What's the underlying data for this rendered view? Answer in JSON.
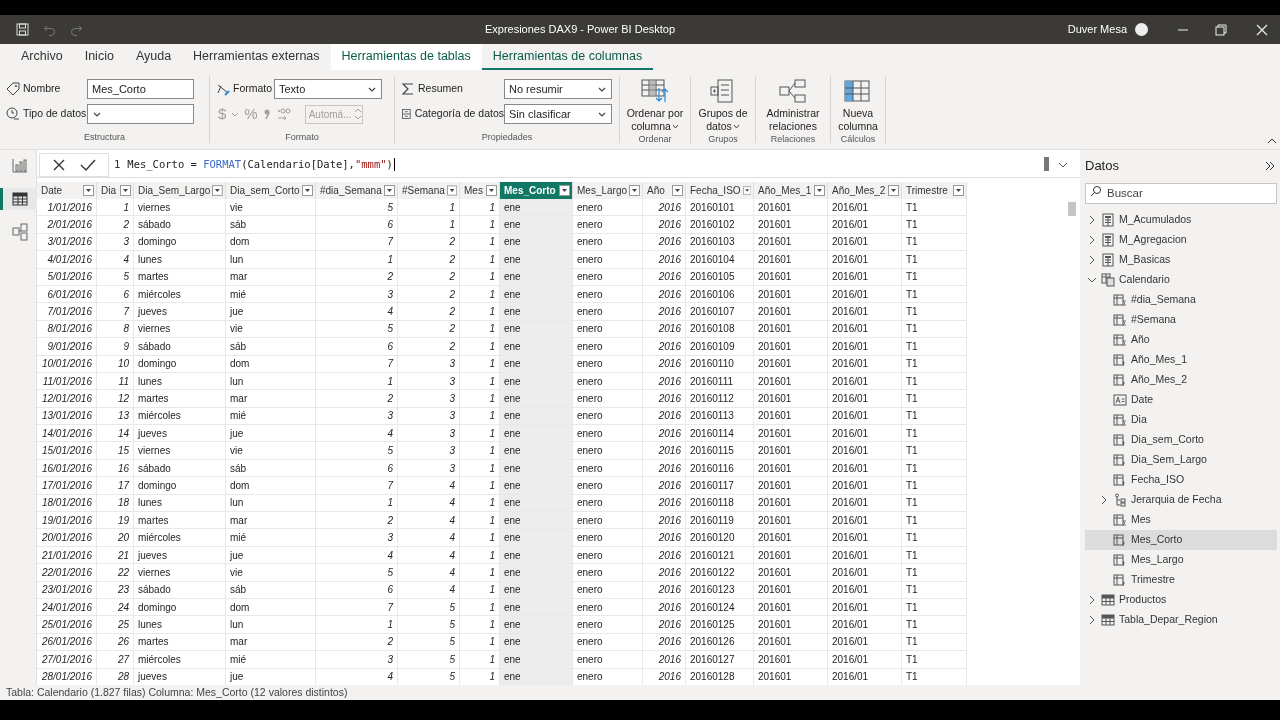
{
  "window": {
    "title": "Expresiones DAX9 - Power BI Desktop",
    "user": "Duver Mesa"
  },
  "menu_tabs": [
    {
      "label": "Archivo",
      "kind": "standard",
      "selected": false
    },
    {
      "label": "Inicio",
      "kind": "standard",
      "selected": false
    },
    {
      "label": "Ayuda",
      "kind": "standard",
      "selected": false
    },
    {
      "label": "Herramientas externas",
      "kind": "standard",
      "selected": false
    },
    {
      "label": "Herramientas de tablas",
      "kind": "contextual",
      "selected": false
    },
    {
      "label": "Herramientas de columnas",
      "kind": "contextual",
      "selected": true
    }
  ],
  "ribbon": {
    "structure": {
      "label": "Estructura",
      "name_label": "Nombre",
      "name_value": "Mes_Corto",
      "type_label": "Tipo de datos"
    },
    "format": {
      "label": "Formato",
      "format_label": "Formato",
      "format_value": "Texto",
      "currency": "$",
      "percent": "%",
      "decimals_placeholder": "Automá..."
    },
    "properties": {
      "label": "Propiedades",
      "summary_label": "Resumen",
      "summary_value": "No resumir",
      "category_label": "Categoría de datos",
      "category_value": "Sin clasificar"
    },
    "big_groups": [
      {
        "label": "Ordenar",
        "button": "Ordenar por columna",
        "kind": "sort",
        "dropdown": true
      },
      {
        "label": "Grupos",
        "button": "Grupos de datos",
        "kind": "groups",
        "dropdown": true
      },
      {
        "label": "Relaciones",
        "button": "Administrar relaciones",
        "kind": "relations",
        "dropdown": false
      },
      {
        "label": "Cálculos",
        "button": "Nueva columna",
        "kind": "column",
        "dropdown": false
      }
    ]
  },
  "views": [
    {
      "kind": "report",
      "selected": false
    },
    {
      "kind": "table",
      "selected": true
    },
    {
      "kind": "model",
      "selected": false
    }
  ],
  "formula": {
    "line": "1",
    "parts": [
      {
        "text": "Mes_Corto = ",
        "kind": "plain"
      },
      {
        "text": "FORMAT",
        "kind": "function"
      },
      {
        "text": "(Calendario[Date],",
        "kind": "plain"
      },
      {
        "text": "\"mmm\"",
        "kind": "string"
      },
      {
        "text": ")",
        "kind": "plain"
      }
    ]
  },
  "table": {
    "columns": [
      {
        "label": "Date",
        "kind": "number",
        "selected": false
      },
      {
        "label": "Dia",
        "kind": "number",
        "selected": false
      },
      {
        "label": "Dia_Sem_Largo",
        "kind": "text",
        "selected": false
      },
      {
        "label": "Dia_sem_Corto",
        "kind": "text",
        "selected": false
      },
      {
        "label": "#dia_Semana",
        "kind": "number",
        "selected": false
      },
      {
        "label": "#Semana",
        "kind": "number",
        "selected": false
      },
      {
        "label": "Mes",
        "kind": "number",
        "selected": false
      },
      {
        "label": "Mes_Corto",
        "kind": "text",
        "selected": true
      },
      {
        "label": "Mes_Largo",
        "kind": "text",
        "selected": false
      },
      {
        "label": "Año",
        "kind": "number",
        "selected": false
      },
      {
        "label": "Fecha_ISO",
        "kind": "text",
        "selected": false
      },
      {
        "label": "Año_Mes_1",
        "kind": "text",
        "selected": false
      },
      {
        "label": "Año_Mes_2",
        "kind": "text",
        "selected": false
      },
      {
        "label": "Trimestre",
        "kind": "text",
        "selected": false
      }
    ],
    "rows": [
      [
        "1/01/2016",
        "1",
        "viernes",
        "vie",
        "5",
        "1",
        "1",
        "ene",
        "enero",
        "2016",
        "20160101",
        "201601",
        "2016/01",
        "T1"
      ],
      [
        "2/01/2016",
        "2",
        "sábado",
        "sáb",
        "6",
        "1",
        "1",
        "ene",
        "enero",
        "2016",
        "20160102",
        "201601",
        "2016/01",
        "T1"
      ],
      [
        "3/01/2016",
        "3",
        "domingo",
        "dom",
        "7",
        "2",
        "1",
        "ene",
        "enero",
        "2016",
        "20160103",
        "201601",
        "2016/01",
        "T1"
      ],
      [
        "4/01/2016",
        "4",
        "lunes",
        "lun",
        "1",
        "2",
        "1",
        "ene",
        "enero",
        "2016",
        "20160104",
        "201601",
        "2016/01",
        "T1"
      ],
      [
        "5/01/2016",
        "5",
        "martes",
        "mar",
        "2",
        "2",
        "1",
        "ene",
        "enero",
        "2016",
        "20160105",
        "201601",
        "2016/01",
        "T1"
      ],
      [
        "6/01/2016",
        "6",
        "miércoles",
        "mié",
        "3",
        "2",
        "1",
        "ene",
        "enero",
        "2016",
        "20160106",
        "201601",
        "2016/01",
        "T1"
      ],
      [
        "7/01/2016",
        "7",
        "jueves",
        "jue",
        "4",
        "2",
        "1",
        "ene",
        "enero",
        "2016",
        "20160107",
        "201601",
        "2016/01",
        "T1"
      ],
      [
        "8/01/2016",
        "8",
        "viernes",
        "vie",
        "5",
        "2",
        "1",
        "ene",
        "enero",
        "2016",
        "20160108",
        "201601",
        "2016/01",
        "T1"
      ],
      [
        "9/01/2016",
        "9",
        "sábado",
        "sáb",
        "6",
        "2",
        "1",
        "ene",
        "enero",
        "2016",
        "20160109",
        "201601",
        "2016/01",
        "T1"
      ],
      [
        "10/01/2016",
        "10",
        "domingo",
        "dom",
        "7",
        "3",
        "1",
        "ene",
        "enero",
        "2016",
        "20160110",
        "201601",
        "2016/01",
        "T1"
      ],
      [
        "11/01/2016",
        "11",
        "lunes",
        "lun",
        "1",
        "3",
        "1",
        "ene",
        "enero",
        "2016",
        "20160111",
        "201601",
        "2016/01",
        "T1"
      ],
      [
        "12/01/2016",
        "12",
        "martes",
        "mar",
        "2",
        "3",
        "1",
        "ene",
        "enero",
        "2016",
        "20160112",
        "201601",
        "2016/01",
        "T1"
      ],
      [
        "13/01/2016",
        "13",
        "miércoles",
        "mié",
        "3",
        "3",
        "1",
        "ene",
        "enero",
        "2016",
        "20160113",
        "201601",
        "2016/01",
        "T1"
      ],
      [
        "14/01/2016",
        "14",
        "jueves",
        "jue",
        "4",
        "3",
        "1",
        "ene",
        "enero",
        "2016",
        "20160114",
        "201601",
        "2016/01",
        "T1"
      ],
      [
        "15/01/2016",
        "15",
        "viernes",
        "vie",
        "5",
        "3",
        "1",
        "ene",
        "enero",
        "2016",
        "20160115",
        "201601",
        "2016/01",
        "T1"
      ],
      [
        "16/01/2016",
        "16",
        "sábado",
        "sáb",
        "6",
        "3",
        "1",
        "ene",
        "enero",
        "2016",
        "20160116",
        "201601",
        "2016/01",
        "T1"
      ],
      [
        "17/01/2016",
        "17",
        "domingo",
        "dom",
        "7",
        "4",
        "1",
        "ene",
        "enero",
        "2016",
        "20160117",
        "201601",
        "2016/01",
        "T1"
      ],
      [
        "18/01/2016",
        "18",
        "lunes",
        "lun",
        "1",
        "4",
        "1",
        "ene",
        "enero",
        "2016",
        "20160118",
        "201601",
        "2016/01",
        "T1"
      ],
      [
        "19/01/2016",
        "19",
        "martes",
        "mar",
        "2",
        "4",
        "1",
        "ene",
        "enero",
        "2016",
        "20160119",
        "201601",
        "2016/01",
        "T1"
      ],
      [
        "20/01/2016",
        "20",
        "miércoles",
        "mié",
        "3",
        "4",
        "1",
        "ene",
        "enero",
        "2016",
        "20160120",
        "201601",
        "2016/01",
        "T1"
      ],
      [
        "21/01/2016",
        "21",
        "jueves",
        "jue",
        "4",
        "4",
        "1",
        "ene",
        "enero",
        "2016",
        "20160121",
        "201601",
        "2016/01",
        "T1"
      ],
      [
        "22/01/2016",
        "22",
        "viernes",
        "vie",
        "5",
        "4",
        "1",
        "ene",
        "enero",
        "2016",
        "20160122",
        "201601",
        "2016/01",
        "T1"
      ],
      [
        "23/01/2016",
        "23",
        "sábado",
        "sáb",
        "6",
        "4",
        "1",
        "ene",
        "enero",
        "2016",
        "20160123",
        "201601",
        "2016/01",
        "T1"
      ],
      [
        "24/01/2016",
        "24",
        "domingo",
        "dom",
        "7",
        "5",
        "1",
        "ene",
        "enero",
        "2016",
        "20160124",
        "201601",
        "2016/01",
        "T1"
      ],
      [
        "25/01/2016",
        "25",
        "lunes",
        "lun",
        "1",
        "5",
        "1",
        "ene",
        "enero",
        "2016",
        "20160125",
        "201601",
        "2016/01",
        "T1"
      ],
      [
        "26/01/2016",
        "26",
        "martes",
        "mar",
        "2",
        "5",
        "1",
        "ene",
        "enero",
        "2016",
        "20160126",
        "201601",
        "2016/01",
        "T1"
      ],
      [
        "27/01/2016",
        "27",
        "miércoles",
        "mié",
        "3",
        "5",
        "1",
        "ene",
        "enero",
        "2016",
        "20160127",
        "201601",
        "2016/01",
        "T1"
      ],
      [
        "28/01/2016",
        "28",
        "jueves",
        "jue",
        "4",
        "5",
        "1",
        "ene",
        "enero",
        "2016",
        "20160128",
        "201601",
        "2016/01",
        "T1"
      ]
    ]
  },
  "data_pane": {
    "title": "Datos",
    "search_placeholder": "Buscar",
    "items": [
      {
        "label": "M_Acumulados",
        "kind": "measures",
        "expanded": false,
        "selected": false
      },
      {
        "label": "M_Agregacion",
        "kind": "measures",
        "expanded": false,
        "selected": false
      },
      {
        "label": "M_Basicas",
        "kind": "measures",
        "expanded": false,
        "selected": false
      },
      {
        "label": "Calendario",
        "kind": "date_table",
        "expanded": true,
        "selected": false,
        "children": [
          {
            "label": "#dia_Semana",
            "kind": "number",
            "selected": false
          },
          {
            "label": "#Semana",
            "kind": "number",
            "selected": false
          },
          {
            "label": "Año",
            "kind": "number",
            "selected": false
          },
          {
            "label": "Año_Mes_1",
            "kind": "calculated",
            "selected": false
          },
          {
            "label": "Año_Mes_2",
            "kind": "calculated",
            "selected": false
          },
          {
            "label": "Date",
            "kind": "text",
            "selected": false
          },
          {
            "label": "Dia",
            "kind": "number",
            "selected": false
          },
          {
            "label": "Dia_sem_Corto",
            "kind": "calculated",
            "selected": false
          },
          {
            "label": "Dia_Sem_Largo",
            "kind": "calculated",
            "selected": false
          },
          {
            "label": "Fecha_ISO",
            "kind": "calculated",
            "selected": false
          },
          {
            "label": "Jerarquia de Fecha",
            "kind": "hierarchy",
            "expanded": false,
            "selected": false
          },
          {
            "label": "Mes",
            "kind": "number",
            "selected": false
          },
          {
            "label": "Mes_Corto",
            "kind": "calculated",
            "selected": true
          },
          {
            "label": "Mes_Largo",
            "kind": "calculated",
            "selected": false
          },
          {
            "label": "Trimestre",
            "kind": "calculated",
            "selected": false
          }
        ]
      },
      {
        "label": "Productos",
        "kind": "table",
        "expanded": false,
        "selected": false
      },
      {
        "label": "Tabla_Depar_Region",
        "kind": "table",
        "expanded": false,
        "selected": false
      }
    ]
  },
  "status_bar": "Tabla: Calendario (1.827 filas) Columna: Mes_Corto (12 valores distintos)"
}
